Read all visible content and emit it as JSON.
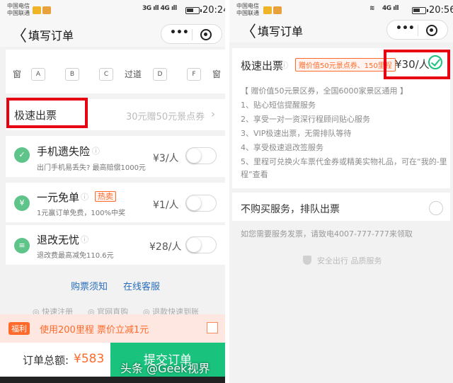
{
  "left_screen": {
    "status": {
      "carrier1": "中国电信",
      "carrier2": "中国联通",
      "signal": "3G ıll 4G ıll",
      "time": "20:24"
    },
    "title": "填写订单",
    "back_glyph": "〈",
    "seat_row": [
      "窗",
      "A",
      "B",
      "C",
      "过道",
      "D",
      "F",
      "窗"
    ],
    "express": {
      "label": "极速出票",
      "value": "30元赠50元景点券"
    },
    "insurance": [
      {
        "title": "手机遗失险",
        "sub": "出门手机易丢失? 最高赔偿1000元",
        "price": "¥3/人",
        "icon_text": "✓",
        "icon": "shield-icon"
      },
      {
        "title": "一元免单",
        "badge": "热卖",
        "sub": "1元赢订单免费，100%中奖",
        "price": "¥1/人",
        "icon_text": "¥",
        "icon": "ticket-icon"
      },
      {
        "title": "退改无忧",
        "sub": "退改费最高减免110.6元",
        "price": "¥28/人",
        "icon_text": "≡",
        "icon": "document-icon"
      }
    ],
    "links": {
      "notice": "购票须知",
      "service": "在线客服"
    },
    "footer_links": [
      "◎ 快速注册",
      "◎ 官网直购",
      "◎ 退款快速到账"
    ],
    "bonus": {
      "badge": "福利",
      "text": "使用200里程 票价立减1元"
    },
    "bottom": {
      "total_label": "订单总额:",
      "total_value": "¥583",
      "submit": "提交订单"
    }
  },
  "right_screen": {
    "status": {
      "carrier1": "中国电信",
      "carrier2": "中国联通",
      "signal": "4G ıll",
      "time": "20:56"
    },
    "title": "填写订单",
    "back_glyph": "〈",
    "express": {
      "title": "极速出票",
      "tag": "赠价值50元景点券、150里程",
      "price": "¥30/人",
      "lines": [
        "【 赠价值50元景区券，全国6000家景区通用 】",
        "1、贴心短信提醒服务",
        "2、享受一对一资深行程顾问贴心服务",
        "3、VIP极速出票，无需排队等待",
        "4、享受极速退改签服务",
        "5、里程可兑换火车票代金券或精美实物礼品，可在“我的-里",
        "程”查看"
      ]
    },
    "no_buy": "不购买服务，排队出票",
    "contact": "如您需要服务发票，请致电4007-777-777来领取",
    "safe": "安全出行 品质服务"
  },
  "watermark": "头条 @Geek视界",
  "colors": {
    "accent": "#19c27d",
    "orange": "#ff6a2b",
    "highlight": "#e60012",
    "link": "#2a6ebb"
  }
}
